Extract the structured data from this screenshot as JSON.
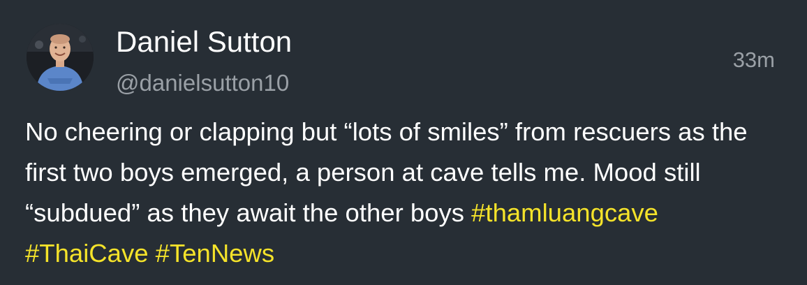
{
  "author": {
    "display_name": "Daniel Sutton",
    "handle": "@danielsutton10",
    "avatar_icon": "user-avatar"
  },
  "timestamp": "33m",
  "body": {
    "lines": [
      "No cheering or clapping but “lots of smiles” from rescuers as the",
      "first two boys emerged, a person at cave tells me. Mood still",
      "“subdued” as they await the other boys "
    ],
    "hashtags": [
      "#thamluangcave",
      "#ThaiCave",
      "#TenNews"
    ]
  },
  "colors": {
    "background": "#272e35",
    "text": "#ffffff",
    "secondary_text": "#9aa0a6",
    "hashtag": "#f5e32a"
  }
}
